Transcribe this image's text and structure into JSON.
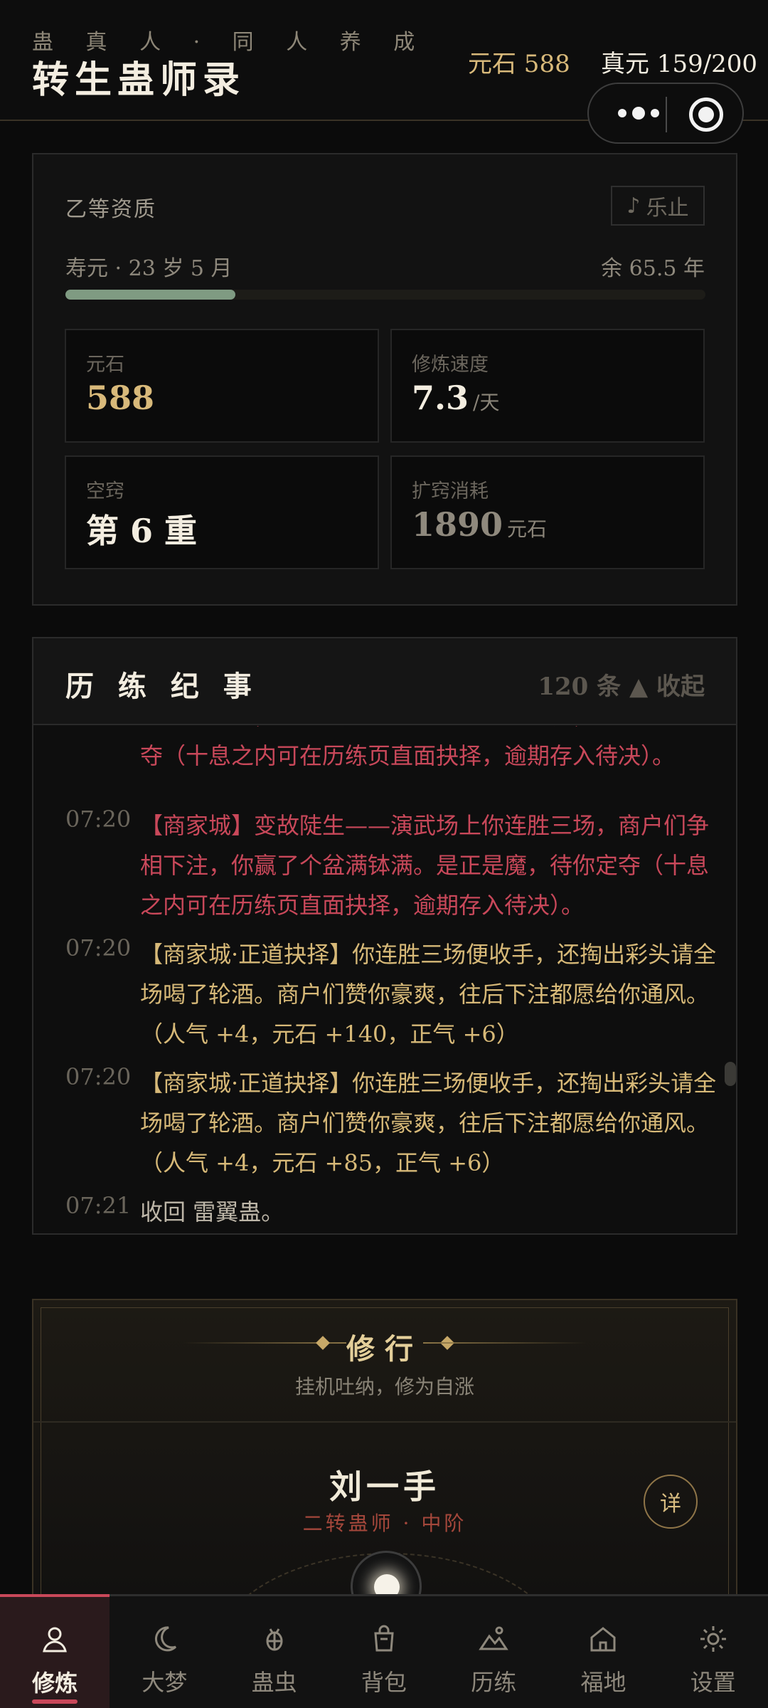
{
  "header": {
    "subtitle": "蛊 真 人 · 同 人 养 成",
    "title": "转生蛊师录",
    "stone_stat": "元石 588",
    "zhenyuan_stat": "真元 159/200"
  },
  "status": {
    "quality": "乙等资质",
    "music_button": "乐止",
    "music_icon": "♪",
    "lifespan": "寿元 · 23 岁 5 月",
    "remaining": "余 65.5 年",
    "life_progress": 0.265,
    "boxes": [
      {
        "label": "元石",
        "value": "588",
        "unit": "",
        "color": "#d8b97a"
      },
      {
        "label": "修炼速度",
        "value": "7.3",
        "unit": "/天",
        "color": "#f3ede0"
      },
      {
        "label": "空窍",
        "value": "第 6 重",
        "unit": "",
        "color": "#f3ede0"
      },
      {
        "label": "扩窍消耗",
        "value": "1890",
        "unit": "元石",
        "color": "#8f897d"
      }
    ]
  },
  "log": {
    "title": "历 练 纪 事",
    "meta": "120 条 ▲ 收起",
    "entries": [
      {
        "time": "",
        "text": "们争相下注，你赢了个盆满钵满。是正是魔，待你定夺（十息之内可在历练页直面抉择，逾期存入待决）。",
        "tone": "red"
      },
      {
        "time": "07:20",
        "text": "【商家城】变故陡生——演武场上你连胜三场，商户们争相下注，你赢了个盆满钵满。是正是魔，待你定夺（十息之内可在历练页直面抉择，逾期存入待决）。",
        "tone": "red"
      },
      {
        "time": "07:20",
        "text": "【商家城·正道抉择】你连胜三场便收手，还掏出彩头请全场喝了轮酒。商户们赞你豪爽，往后下注都愿给你通风。（人气 +4，元石 +140，正气 +6）",
        "tone": "gold"
      },
      {
        "time": "07:20",
        "text": "【商家城·正道抉择】你连胜三场便收手，还掏出彩头请全场喝了轮酒。商户们赞你豪爽，往后下注都愿给你通风。（人气 +4，元石 +85，正气 +6）",
        "tone": "gold"
      },
      {
        "time": "07:21",
        "text": "收回 雷翼蛊。",
        "tone": "gray"
      }
    ]
  },
  "cultivation": {
    "title": "修行",
    "subtitle": "挂机吐纳，修为自涨",
    "name": "刘一手",
    "rank": "二转蛊师 · 中阶",
    "detail_button": "详"
  },
  "tabs": [
    {
      "label": "修炼",
      "icon": "person-icon",
      "active": true
    },
    {
      "label": "大梦",
      "icon": "moon-icon",
      "active": false
    },
    {
      "label": "蛊虫",
      "icon": "bug-icon",
      "active": false
    },
    {
      "label": "背包",
      "icon": "bag-icon",
      "active": false
    },
    {
      "label": "历练",
      "icon": "mountain-icon",
      "active": false
    },
    {
      "label": "福地",
      "icon": "home-icon",
      "active": false
    },
    {
      "label": "设置",
      "icon": "gear-icon",
      "active": false
    }
  ],
  "colors": {
    "accent": "#c9485a",
    "gold": "#d7b978",
    "progress": "#7f9b82"
  }
}
